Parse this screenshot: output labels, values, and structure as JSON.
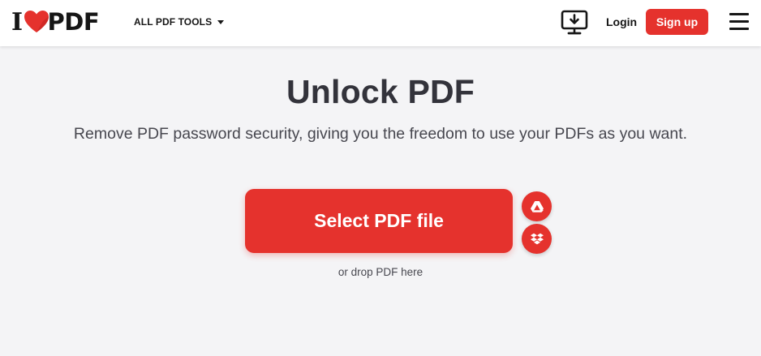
{
  "header": {
    "logo": {
      "left": "I",
      "right": "PDF"
    },
    "tools_menu_label": "ALL PDF TOOLS",
    "login_label": "Login",
    "signup_label": "Sign up",
    "icons": [
      "heart-icon",
      "desktop-download-icon",
      "caret-down-icon",
      "hamburger-menu-icon"
    ]
  },
  "main": {
    "title": "Unlock PDF",
    "subtitle": "Remove PDF password security, giving you the freedom to use your PDFs as you want.",
    "select_button_label": "Select PDF file",
    "drop_hint": "or drop PDF here",
    "cloud_icons": [
      "google-drive-icon",
      "dropbox-icon"
    ]
  },
  "colors": {
    "brand_red": "#e5322d",
    "background": "#f4f4f6",
    "header_bg": "#ffffff",
    "text_dark": "#33333b"
  }
}
